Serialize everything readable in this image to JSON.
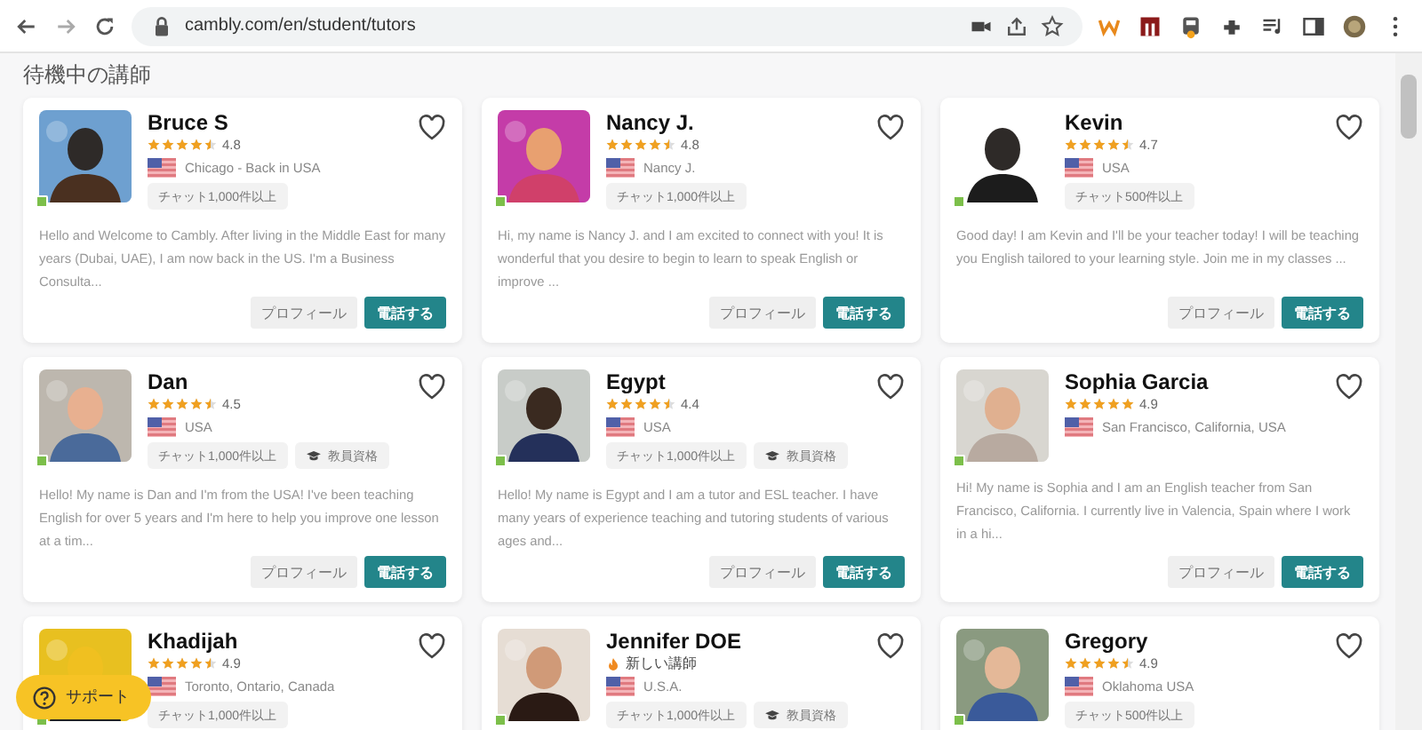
{
  "browser": {
    "url": "cambly.com/en/student/tutors"
  },
  "heading": "待機中の講師",
  "tutors": [
    {
      "name": "Bruce S",
      "rating": {
        "kind": "stars",
        "stars": 4.5,
        "score": "4.8"
      },
      "location": "Chicago - Back in USA",
      "online": true,
      "tags": [
        {
          "kind": "chat",
          "label": "チャット1,000件以上"
        }
      ],
      "description": "Hello and Welcome to Cambly. After living in the Middle East for many years (Dubai, UAE), I am now back in the US. I'm a Business Consulta...",
      "buttons": [
        "プロフィール",
        "電話する"
      ]
    },
    {
      "name": "Nancy J.",
      "rating": {
        "kind": "stars",
        "stars": 4.5,
        "score": "4.8"
      },
      "location": "Nancy J.",
      "online": true,
      "tags": [
        {
          "kind": "chat",
          "label": "チャット1,000件以上"
        }
      ],
      "description": "Hi, my name is Nancy J. and I am excited to connect with you! It is wonderful that you desire to begin to learn to speak English or improve ...",
      "buttons": [
        "プロフィール",
        "電話する"
      ]
    },
    {
      "name": "Kevin",
      "rating": {
        "kind": "stars",
        "stars": 4.5,
        "score": "4.7"
      },
      "location": "USA",
      "online": true,
      "tags": [
        {
          "kind": "chat",
          "label": "チャット500件以上"
        }
      ],
      "description": "Good day! I am Kevin and I'll be your teacher today! I will be teaching you English tailored to your learning style. Join me in my classes ...",
      "buttons": [
        "プロフィール",
        "電話する"
      ]
    },
    {
      "name": "Dan",
      "rating": {
        "kind": "stars",
        "stars": 4.5,
        "score": "4.5"
      },
      "location": "USA",
      "online": true,
      "tags": [
        {
          "kind": "chat",
          "label": "チャット1,000件以上"
        },
        {
          "kind": "certificate",
          "label": "教員資格"
        }
      ],
      "description": "Hello! My name is Dan and I'm from the USA! I've been teaching English for over 5 years and I'm here to help you improve one lesson at a tim...",
      "buttons": [
        "プロフィール",
        "電話する"
      ]
    },
    {
      "name": "Egypt",
      "rating": {
        "kind": "stars",
        "stars": 4.5,
        "score": "4.4"
      },
      "location": "USA",
      "online": true,
      "tags": [
        {
          "kind": "chat",
          "label": "チャット1,000件以上"
        },
        {
          "kind": "certificate",
          "label": "教員資格"
        }
      ],
      "description": "Hello! My name is Egypt and I am a tutor and ESL teacher. I have many years of experience teaching and tutoring students of various ages and...",
      "buttons": [
        "プロフィール",
        "電話する"
      ]
    },
    {
      "name": "Sophia Garcia",
      "rating": {
        "kind": "stars",
        "stars": 5,
        "score": "4.9"
      },
      "location": "San Francisco, California, USA",
      "online": true,
      "description": "Hi! My name is Sophia and I am an English teacher from San Francisco, California. I currently live in Valencia, Spain where I work in a hi...",
      "buttons": [
        "プロフィール",
        "電話する"
      ]
    },
    {
      "name": "Khadijah",
      "rating": {
        "kind": "stars",
        "stars": 4.5,
        "score": "4.9"
      },
      "location": "Toronto, Ontario, Canada",
      "online": true,
      "tags": [
        {
          "kind": "chat",
          "label": "チャット1,000件以上"
        }
      ]
    },
    {
      "name": "Jennifer DOE",
      "rating": {
        "kind": "new",
        "label": "新しい講師"
      },
      "location": "U.S.A.",
      "online": true,
      "tags": [
        {
          "kind": "chat",
          "label": "チャット1,000件以上"
        },
        {
          "kind": "certificate",
          "label": "教員資格"
        }
      ]
    },
    {
      "name": "Gregory",
      "rating": {
        "kind": "stars",
        "stars": 4.5,
        "score": "4.9"
      },
      "location": "Oklahoma USA",
      "online": true,
      "tags": [
        {
          "kind": "chat",
          "label": "チャット500件以上"
        }
      ]
    }
  ],
  "support_button": "サポート"
}
